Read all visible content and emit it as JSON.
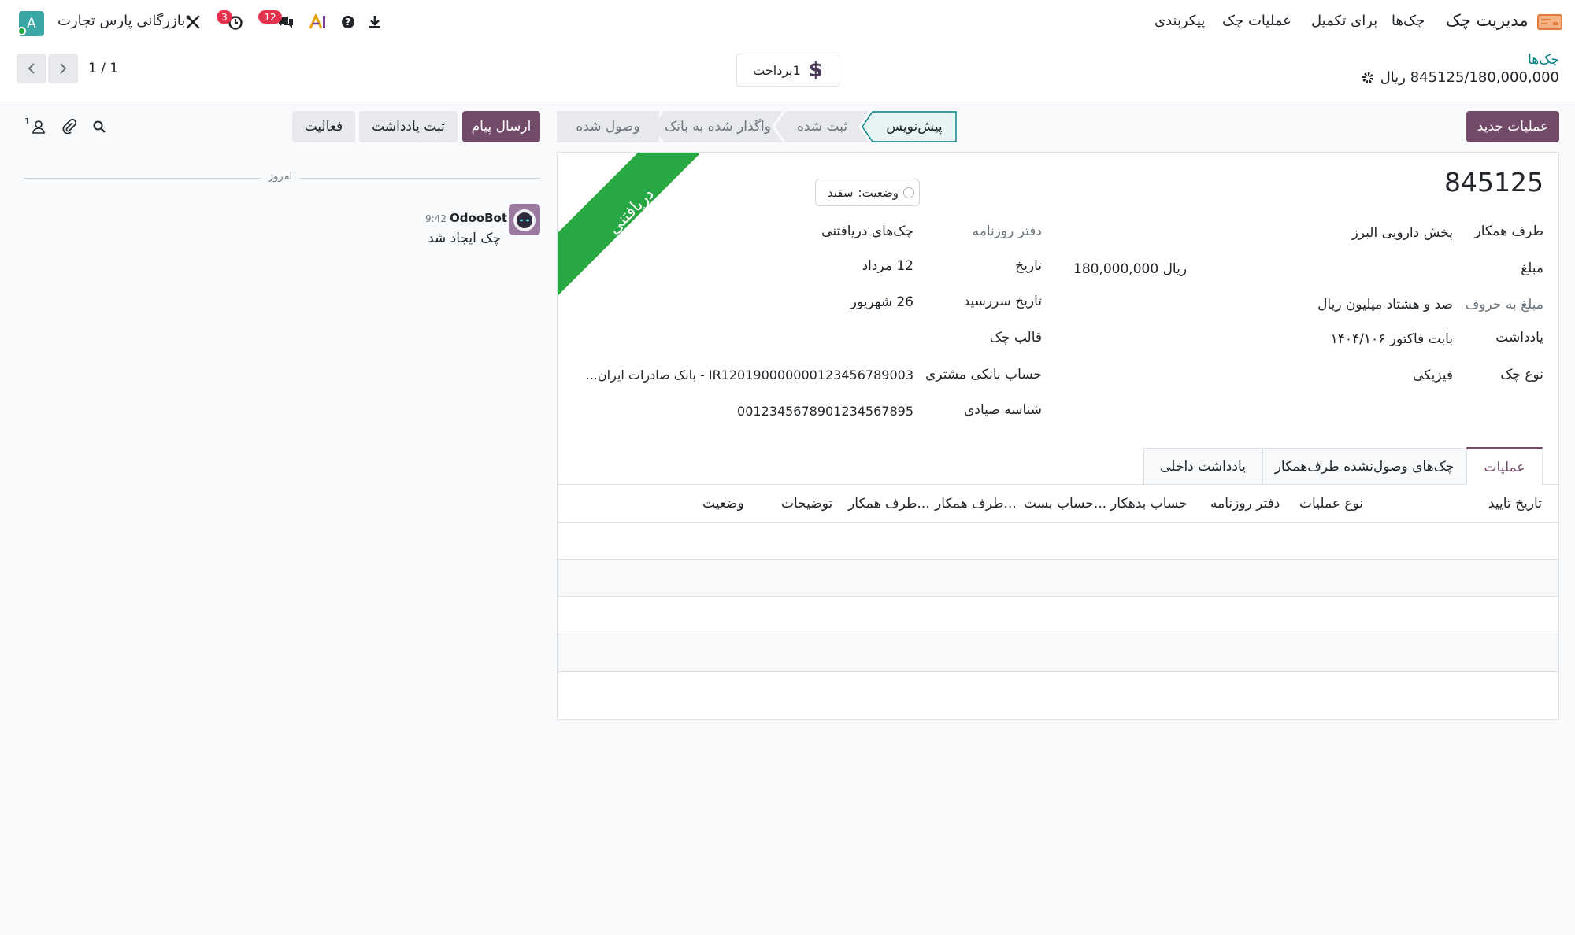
{
  "topnav": {
    "app_name": "مدیریت چک",
    "menu": [
      "چک‌ها",
      "برای تکمیل",
      "عملیات چک",
      "پیکربندی"
    ],
    "company": "بازرگانی پارس تجارت",
    "activity_badge": "3",
    "messages_badge": "12",
    "avatar_letter": "A"
  },
  "control": {
    "breadcrumb_parent": "چک‌ها",
    "record_title": "845125/180,000,000 ریال",
    "payment_button": "1پرداخت",
    "pager": "1 / 1",
    "new_operation_button": "عملیات جدید"
  },
  "statusbar": {
    "stages": [
      "پیش‌نویس",
      "ثبت شده",
      "واگذار شده به بانک",
      "وصول شده"
    ],
    "active": "پیش‌نویس"
  },
  "chatter": {
    "send_message": "ارسال پیام",
    "log_note": "ثبت یادداشت",
    "activity": "فعالیت",
    "followers_count": "1",
    "today": "امروز",
    "message_author": "OdooBot",
    "message_time": "9:42",
    "message_body": "چک ایجاد شد"
  },
  "form": {
    "check_number": "845125",
    "ribbon": "دریافتنی",
    "status_label": "وضعیت:",
    "status_value": "سفید",
    "partner_label": "طرف همکار",
    "partner_value": "پخش دارویی البرز",
    "amount_label": "مبلغ",
    "amount_value": "180,000,000 ریال",
    "amount_words_label": "مبلغ به حروف",
    "amount_words_value": "صد و هشتاد میلیون ریال",
    "memo_label": "یادداشت",
    "memo_value": "بابت فاکتور ۱۴۰۴/۱۰۶",
    "check_type_label": "نوع چک",
    "check_type_value": "فیزیکی",
    "journal_label": "دفتر روزنامه",
    "journal_value": "چک‌های دریافتنی",
    "date_label": "تاریخ",
    "date_value": "12 مرداد",
    "due_date_label": "تاریخ سررسید",
    "due_date_value": "26 شهریور",
    "template_label": "قالب چک",
    "bank_account_label": "حساب بانکی مشتری",
    "bank_account_value": "IR120190000000123456789003 - بانک صادرات ایران...",
    "sayad_label": "شناسه صیادی",
    "sayad_value": "0012345678901234567895"
  },
  "tabs": [
    "عملیات",
    "چک‌های وصول‌نشده طرف‌همکار",
    "یادداشت داخلی"
  ],
  "table": {
    "columns": [
      "تاریخ تایید",
      "نوع عملیات",
      "دفتر روزنامه",
      "حساب بدهکار",
      "حساب بست...",
      "طرف همکار...",
      "طرف همکار...",
      "توضیحات",
      "وضعیت"
    ]
  },
  "colors": {
    "primary": "#714b67",
    "ribbon": "#28a745",
    "active_stage_border": "#017e84",
    "badge": "#e4324d"
  }
}
